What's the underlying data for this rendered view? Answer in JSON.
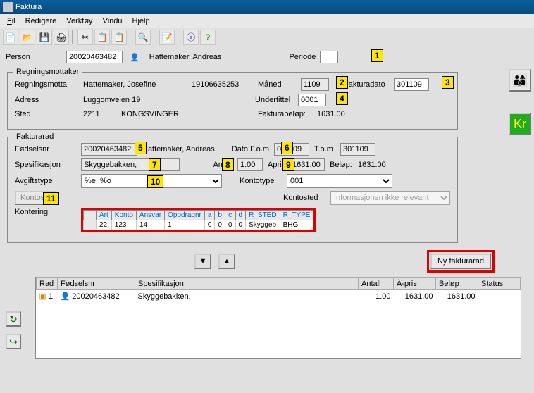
{
  "window": {
    "title": "Faktura"
  },
  "menu": {
    "fil": "Fil",
    "redigere": "Redigere",
    "verktoy": "Verktøy",
    "vindu": "Vindu",
    "hjelp": "Hjelp"
  },
  "personRow": {
    "label": "Person",
    "id": "20020463482",
    "name": "Hattemaker, Andreas",
    "periodeLabel": "Periode",
    "periode": ""
  },
  "regnings": {
    "legend": "Regningsmottaker",
    "mottaLabel": "Regningsmotta",
    "mottaName": "Hattemaker, Josefine",
    "mottaId": "19106635253",
    "adressLabel": "Adress",
    "adress": "Luggomveien 19",
    "stedLabel": "Sted",
    "stedCode": "2211",
    "stedName": "KONGSVINGER",
    "manedLabel": "Måned",
    "maned": "1109",
    "fakturadatoLabel": "Fakturadato",
    "fakturadato": "301109",
    "undertittelLabel": "Undertittel",
    "undertittel": "0001",
    "belopLabel": "Fakturabeløp:",
    "belop": "1631.00"
  },
  "fakturarad": {
    "legend": "Fakturarad",
    "fnrLabel": "Fødselsnr",
    "fnr": "20020463482",
    "fnrName": "Hattemaker, Andreas",
    "datoFomLabel": "Dato F.o.m",
    "datoFom": "011109",
    "tomLabel": "T.o.m",
    "tom": "301109",
    "spesLabel": "Spesifikasjon",
    "spes": "Skyggebakken,",
    "antallLabel": "Antall",
    "antall": "1.00",
    "aprisLabel": "Apris",
    "apris": "1631.00",
    "belopLabel": "Beløp:",
    "belop": "1631.00",
    "avgiftLabel": "Avgiftstype",
    "avgift": "%e, %o",
    "kontotypeLabel": "Kontotype",
    "kontotype": "001",
    "kontosteBtn": "Kontoste",
    "kontostedLabel": "Kontosted",
    "kontosted": "Informasjonen ikke relevant",
    "konteringLabel": "Kontering",
    "kontHeaders": [
      "Art",
      "Konto",
      "Ansvar",
      "Oppdragnr",
      "a",
      "b",
      "c",
      "d",
      "R_STED",
      "R_TYPE"
    ],
    "kontRow": [
      "22",
      "123",
      "14",
      "1",
      "0",
      "0",
      "0",
      "0",
      "Skyggeb",
      "BHG"
    ]
  },
  "nav": {
    "nyFakturarad": "Ny fakturarad"
  },
  "grid": {
    "headers": [
      "Rad",
      "Fødselsnr",
      "Spesifikasjon",
      "Antall",
      "À-pris",
      "Beløp",
      "Status"
    ],
    "row": {
      "rad": "1",
      "fnr": "20020463482",
      "spes": "Skyggebakken,",
      "antall": "1.00",
      "apris": "1631.00",
      "belop": "1631.00",
      "status": ""
    }
  },
  "annotations": {
    "a1": "1",
    "a2": "2",
    "a3": "3",
    "a4": "4",
    "a5": "5",
    "a6": "6",
    "a7": "7",
    "a8": "8",
    "a9": "9",
    "a10": "10",
    "a11": "11"
  }
}
